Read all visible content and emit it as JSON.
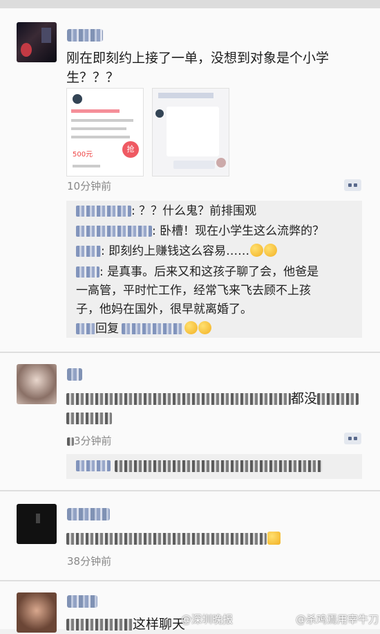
{
  "post1": {
    "text": "刚在即刻约上接了一单，没想到对象是个小学生？？？",
    "time": "10分钟前",
    "shot_price": "500元",
    "shot_button": "抢",
    "comments": [
      {
        "text": ": ？？什么鬼？前排围观"
      },
      {
        "text": ": 卧槽！现在小学生这么流弊的？"
      },
      {
        "text": ": 即刻约上赚钱这么容易……"
      },
      {
        "text_line1": ": 是真事。后来又和这孩子聊了会，他爸是",
        "text_line2": "一高管，平时忙工作，经常飞来飞去顾不上孩",
        "text_line3": "子，他妈在国外，很早就离婚了。"
      },
      {
        "text": "回复"
      }
    ]
  },
  "post2": {
    "text_fragment": "都没",
    "time": "3分钟前"
  },
  "post3": {
    "time": "38分钟前"
  },
  "post4": {
    "text_fragment": "这样聊天"
  },
  "watermark": {
    "left": "@深圳晚报",
    "right": "@杀鸡焉用宰牛刀"
  }
}
